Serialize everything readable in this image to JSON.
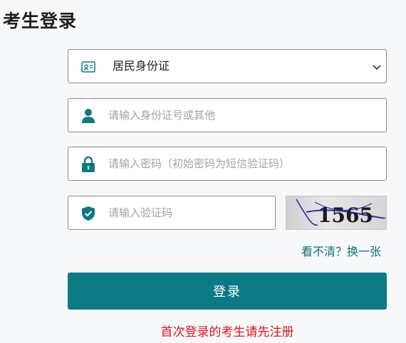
{
  "page": {
    "title": "考生登录"
  },
  "form": {
    "id_type": {
      "selected": "居民身份证",
      "icon": "id-card-icon"
    },
    "id_number": {
      "placeholder": "请输入身份证号或其他",
      "icon": "user-icon"
    },
    "password": {
      "placeholder": "请输入密码（初始密码为短信验证码）",
      "icon": "lock-icon"
    },
    "captcha": {
      "placeholder": "请输入验证码",
      "icon": "shield-check-icon",
      "image_text": "1565"
    },
    "refresh_label": "看不清？换一张",
    "login_label": "登录",
    "register_label": "首次登录的考生请先注册"
  },
  "colors": {
    "primary": "#0c7a84",
    "accent_text": "#0f7079",
    "warning": "#e0141e"
  }
}
